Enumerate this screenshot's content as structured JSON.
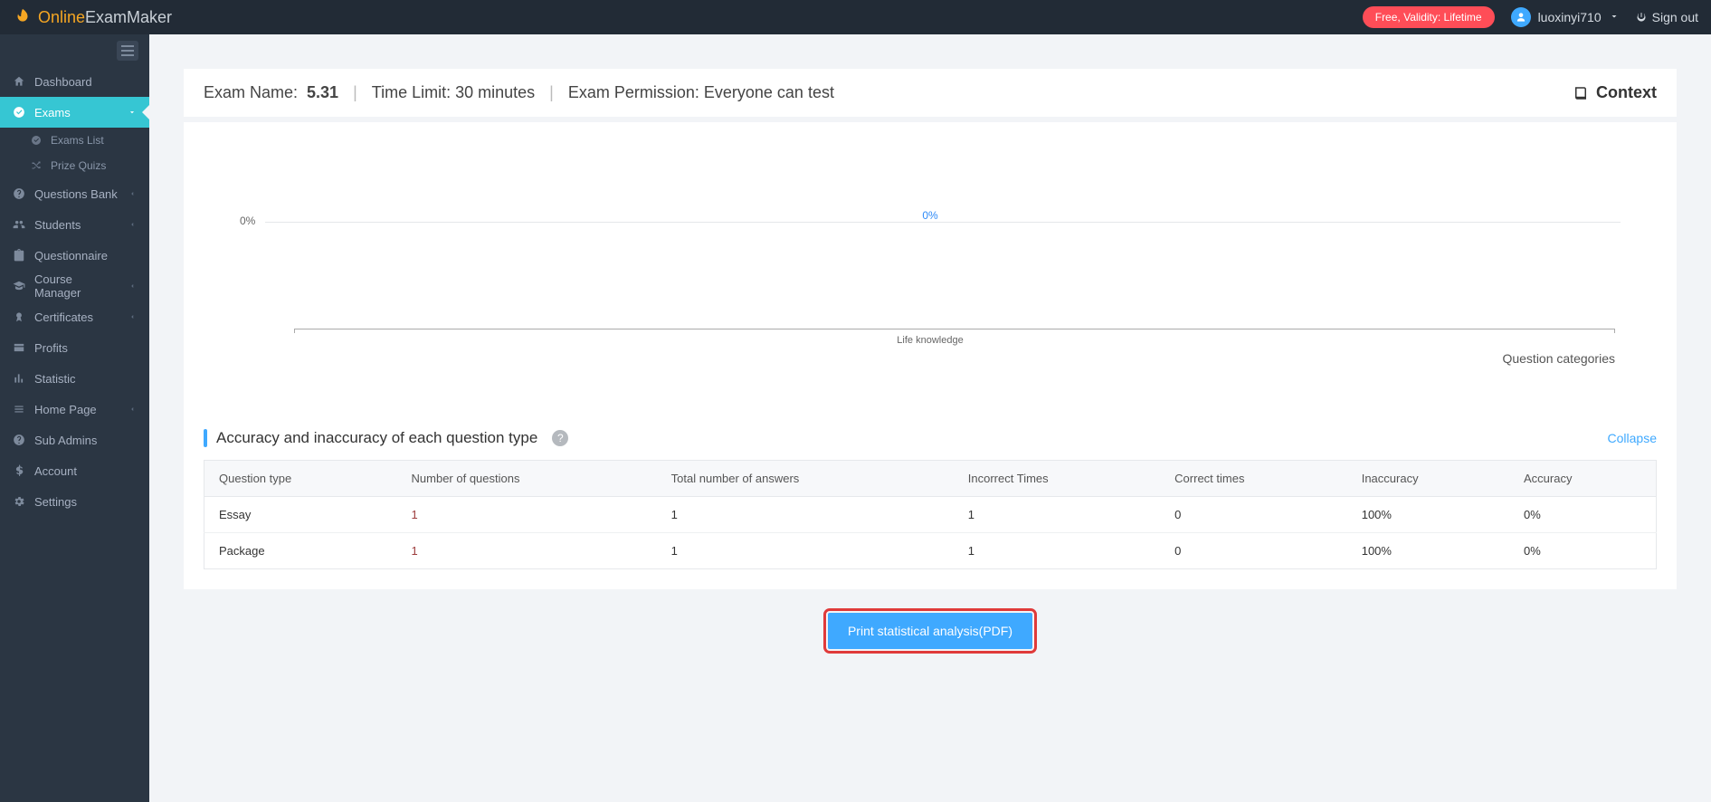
{
  "brand": {
    "left": "Online",
    "right": "ExamMaker"
  },
  "topbar": {
    "badge": "Free, Validity: Lifetime",
    "username": "luoxinyi710",
    "signout": "Sign out"
  },
  "sidebar": {
    "dashboard": "Dashboard",
    "exams": "Exams",
    "exams_list": "Exams List",
    "prize_quizs": "Prize Quizs",
    "questions_bank": "Questions Bank",
    "students": "Students",
    "questionnaire": "Questionnaire",
    "course_manager": "Course Manager",
    "certificates": "Certificates",
    "profits": "Profits",
    "statistic": "Statistic",
    "home_page": "Home Page",
    "sub_admins": "Sub Admins",
    "account": "Account",
    "settings": "Settings"
  },
  "header": {
    "exam_name_label": "Exam Name:",
    "exam_name_value": "5.31",
    "time_limit": "Time Limit: 30 minutes",
    "permission": "Exam Permission: Everyone can test",
    "context": "Context"
  },
  "chart_data": {
    "type": "bar",
    "categories": [
      "Life knowledge"
    ],
    "values": [
      0
    ],
    "value_labels": [
      "0%"
    ],
    "y_tick_labels": [
      "0%"
    ],
    "xlabel": "Question categories",
    "ylabel": "",
    "title": "",
    "ylim": [
      0,
      100
    ]
  },
  "section": {
    "title": "Accuracy and inaccuracy of each question type",
    "collapse": "Collapse"
  },
  "table": {
    "headers": [
      "Question type",
      "Number of questions",
      "Total number of answers",
      "Incorrect Times",
      "Correct times",
      "Inaccuracy",
      "Accuracy"
    ],
    "rows": [
      {
        "type": "Essay",
        "nq": "1",
        "answers": "1",
        "incorrect": "1",
        "correct": "0",
        "inaccuracy": "100%",
        "accuracy": "0%"
      },
      {
        "type": "Package",
        "nq": "1",
        "answers": "1",
        "incorrect": "1",
        "correct": "0",
        "inaccuracy": "100%",
        "accuracy": "0%"
      }
    ]
  },
  "print_button": "Print statistical analysis(PDF)"
}
